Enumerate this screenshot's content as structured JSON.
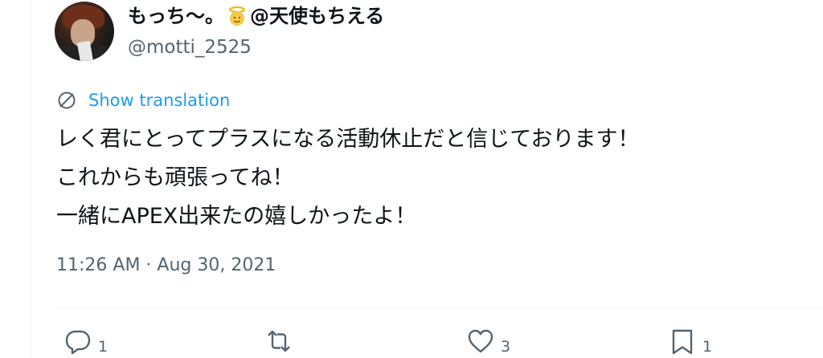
{
  "user": {
    "display_name_prefix": "もっち〜。",
    "display_name_suffix": "@天使もちえる",
    "handle": "@motti_2525"
  },
  "translate": {
    "label": "Show translation"
  },
  "tweet": {
    "lines": [
      "レく君にとってプラスになる活動休止だと信じております！",
      "これからも頑張ってね！",
      "一緒にAPEX出来たの嬉しかったよ！"
    ],
    "timestamp": "11:26 AM · Aug 30, 2021"
  },
  "actions": {
    "reply": {
      "icon": "reply-icon",
      "count": "1"
    },
    "retweet": {
      "icon": "retweet-icon",
      "count": ""
    },
    "like": {
      "icon": "like-icon",
      "count": "3"
    },
    "bookmark": {
      "icon": "bookmark-icon",
      "count": "1"
    }
  },
  "colors": {
    "accent": "#1d9bf0",
    "muted": "#536471",
    "text": "#0f1419"
  }
}
